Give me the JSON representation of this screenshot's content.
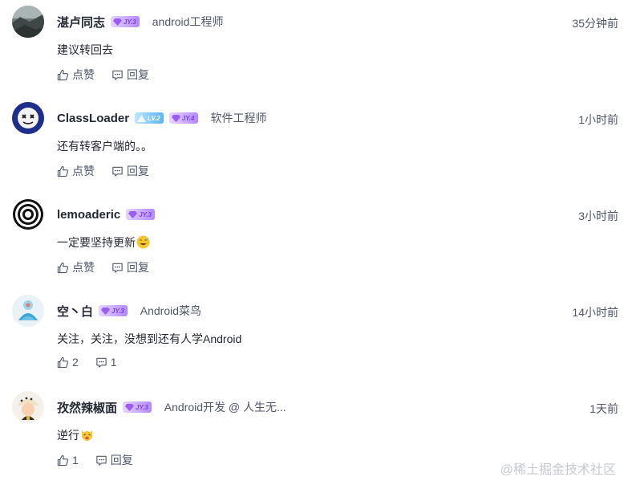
{
  "comments": [
    {
      "username": "湛卢同志",
      "badges": [
        "JY.3"
      ],
      "job_title": "android工程师",
      "time": "35分钟前",
      "content": "建议转回去",
      "like_label": "点赞",
      "reply_label": "回复"
    },
    {
      "username": "ClassLoader",
      "badges": [
        "LV.2",
        "JY.4"
      ],
      "job_title": "软件工程师",
      "time": "1小时前",
      "content": "还有转客户端的。。",
      "like_label": "点赞",
      "reply_label": "回复"
    },
    {
      "username": "lemoaderic",
      "badges": [
        "JY.3"
      ],
      "job_title": "",
      "time": "3小时前",
      "content": "一定要坚持更新",
      "like_label": "点赞",
      "reply_label": "回复"
    },
    {
      "username": "空丶白",
      "badges": [
        "JY.3"
      ],
      "job_title": "Android菜鸟",
      "time": "14小时前",
      "content": "关注，关注，没想到还有人学Android",
      "like_label": "2",
      "reply_label": "1"
    },
    {
      "username": "孜然辣椒面",
      "badges": [
        "JY.3"
      ],
      "job_title": "Android开发 @ 人生无...",
      "time": "1天前",
      "content": "逆行",
      "like_label": "1",
      "reply_label": "回复"
    }
  ],
  "watermark": "@稀土掘金技术社区",
  "colors": {
    "primary_text": "#252933",
    "secondary_text": "#515767",
    "jy_badge": "#b388ff",
    "lv_badge": "#5ab4f4",
    "watermark": "#c6c9d1"
  }
}
